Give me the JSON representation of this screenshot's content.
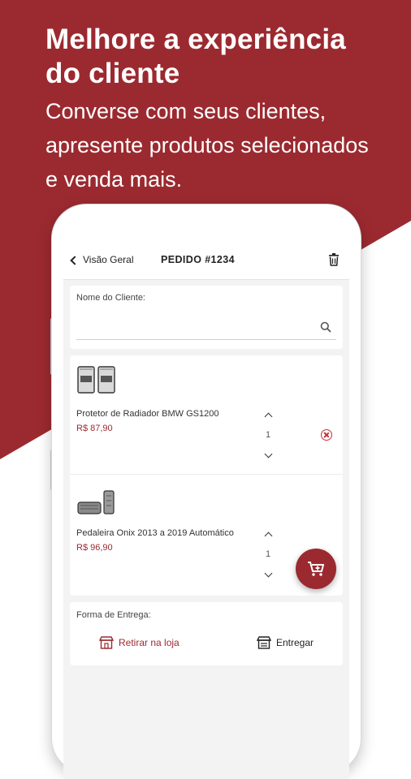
{
  "colors": {
    "brand": "#9b2a30",
    "background": "#ffffff",
    "screen_bg": "#f3f3f3"
  },
  "hero": {
    "title_line1": "Melhore a experiência",
    "title_line2": "do cliente",
    "subtitle_line1": "Converse com seus clientes,",
    "subtitle_line2": "apresente produtos selecionados",
    "subtitle_line3": "e venda mais."
  },
  "appbar": {
    "back_label": "Visão Geral",
    "title": "PEDIDO #1234",
    "trash_icon": "trash-icon"
  },
  "client": {
    "label": "Nome do Cliente:",
    "value": "",
    "search_icon": "search-icon"
  },
  "products": [
    {
      "name": "Protetor de Radiador BMW GS1200",
      "price": "R$ 87,90",
      "quantity": "1"
    },
    {
      "name": "Pedaleira Onix 2013 a 2019 Automático",
      "price": "R$ 96,90",
      "quantity": "1"
    }
  ],
  "delivery": {
    "label": "Forma de Entrega:",
    "options": [
      {
        "label": "Retirar na loja",
        "icon": "store-icon"
      },
      {
        "label": "Entregar",
        "icon": "delivery-icon"
      }
    ]
  },
  "fab": {
    "icon": "add-to-cart-icon"
  }
}
